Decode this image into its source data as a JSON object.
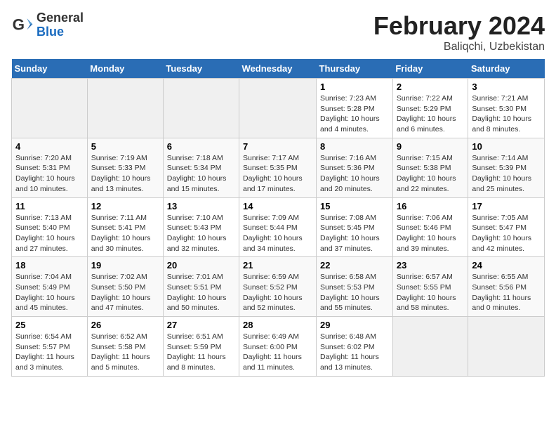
{
  "logo": {
    "general": "General",
    "blue": "Blue"
  },
  "title": "February 2024",
  "subtitle": "Baliqchi, Uzbekistan",
  "days_of_week": [
    "Sunday",
    "Monday",
    "Tuesday",
    "Wednesday",
    "Thursday",
    "Friday",
    "Saturday"
  ],
  "weeks": [
    [
      {
        "day": "",
        "info": ""
      },
      {
        "day": "",
        "info": ""
      },
      {
        "day": "",
        "info": ""
      },
      {
        "day": "",
        "info": ""
      },
      {
        "day": "1",
        "info": "Sunrise: 7:23 AM\nSunset: 5:28 PM\nDaylight: 10 hours\nand 4 minutes."
      },
      {
        "day": "2",
        "info": "Sunrise: 7:22 AM\nSunset: 5:29 PM\nDaylight: 10 hours\nand 6 minutes."
      },
      {
        "day": "3",
        "info": "Sunrise: 7:21 AM\nSunset: 5:30 PM\nDaylight: 10 hours\nand 8 minutes."
      }
    ],
    [
      {
        "day": "4",
        "info": "Sunrise: 7:20 AM\nSunset: 5:31 PM\nDaylight: 10 hours\nand 10 minutes."
      },
      {
        "day": "5",
        "info": "Sunrise: 7:19 AM\nSunset: 5:33 PM\nDaylight: 10 hours\nand 13 minutes."
      },
      {
        "day": "6",
        "info": "Sunrise: 7:18 AM\nSunset: 5:34 PM\nDaylight: 10 hours\nand 15 minutes."
      },
      {
        "day": "7",
        "info": "Sunrise: 7:17 AM\nSunset: 5:35 PM\nDaylight: 10 hours\nand 17 minutes."
      },
      {
        "day": "8",
        "info": "Sunrise: 7:16 AM\nSunset: 5:36 PM\nDaylight: 10 hours\nand 20 minutes."
      },
      {
        "day": "9",
        "info": "Sunrise: 7:15 AM\nSunset: 5:38 PM\nDaylight: 10 hours\nand 22 minutes."
      },
      {
        "day": "10",
        "info": "Sunrise: 7:14 AM\nSunset: 5:39 PM\nDaylight: 10 hours\nand 25 minutes."
      }
    ],
    [
      {
        "day": "11",
        "info": "Sunrise: 7:13 AM\nSunset: 5:40 PM\nDaylight: 10 hours\nand 27 minutes."
      },
      {
        "day": "12",
        "info": "Sunrise: 7:11 AM\nSunset: 5:41 PM\nDaylight: 10 hours\nand 30 minutes."
      },
      {
        "day": "13",
        "info": "Sunrise: 7:10 AM\nSunset: 5:43 PM\nDaylight: 10 hours\nand 32 minutes."
      },
      {
        "day": "14",
        "info": "Sunrise: 7:09 AM\nSunset: 5:44 PM\nDaylight: 10 hours\nand 34 minutes."
      },
      {
        "day": "15",
        "info": "Sunrise: 7:08 AM\nSunset: 5:45 PM\nDaylight: 10 hours\nand 37 minutes."
      },
      {
        "day": "16",
        "info": "Sunrise: 7:06 AM\nSunset: 5:46 PM\nDaylight: 10 hours\nand 39 minutes."
      },
      {
        "day": "17",
        "info": "Sunrise: 7:05 AM\nSunset: 5:47 PM\nDaylight: 10 hours\nand 42 minutes."
      }
    ],
    [
      {
        "day": "18",
        "info": "Sunrise: 7:04 AM\nSunset: 5:49 PM\nDaylight: 10 hours\nand 45 minutes."
      },
      {
        "day": "19",
        "info": "Sunrise: 7:02 AM\nSunset: 5:50 PM\nDaylight: 10 hours\nand 47 minutes."
      },
      {
        "day": "20",
        "info": "Sunrise: 7:01 AM\nSunset: 5:51 PM\nDaylight: 10 hours\nand 50 minutes."
      },
      {
        "day": "21",
        "info": "Sunrise: 6:59 AM\nSunset: 5:52 PM\nDaylight: 10 hours\nand 52 minutes."
      },
      {
        "day": "22",
        "info": "Sunrise: 6:58 AM\nSunset: 5:53 PM\nDaylight: 10 hours\nand 55 minutes."
      },
      {
        "day": "23",
        "info": "Sunrise: 6:57 AM\nSunset: 5:55 PM\nDaylight: 10 hours\nand 58 minutes."
      },
      {
        "day": "24",
        "info": "Sunrise: 6:55 AM\nSunset: 5:56 PM\nDaylight: 11 hours\nand 0 minutes."
      }
    ],
    [
      {
        "day": "25",
        "info": "Sunrise: 6:54 AM\nSunset: 5:57 PM\nDaylight: 11 hours\nand 3 minutes."
      },
      {
        "day": "26",
        "info": "Sunrise: 6:52 AM\nSunset: 5:58 PM\nDaylight: 11 hours\nand 5 minutes."
      },
      {
        "day": "27",
        "info": "Sunrise: 6:51 AM\nSunset: 5:59 PM\nDaylight: 11 hours\nand 8 minutes."
      },
      {
        "day": "28",
        "info": "Sunrise: 6:49 AM\nSunset: 6:00 PM\nDaylight: 11 hours\nand 11 minutes."
      },
      {
        "day": "29",
        "info": "Sunrise: 6:48 AM\nSunset: 6:02 PM\nDaylight: 11 hours\nand 13 minutes."
      },
      {
        "day": "",
        "info": ""
      },
      {
        "day": "",
        "info": ""
      }
    ]
  ]
}
